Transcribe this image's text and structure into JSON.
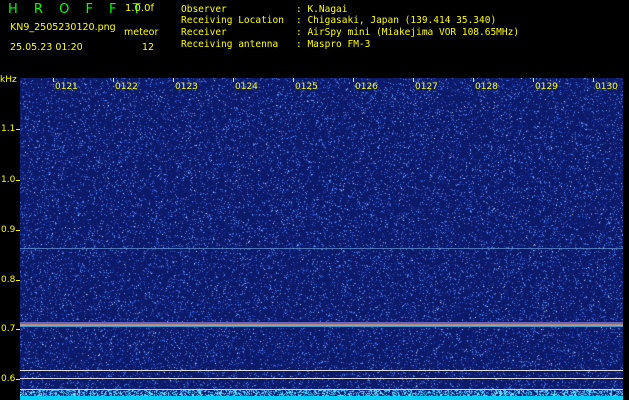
{
  "header": {
    "app_title": "H R O F F T",
    "app_version": "1.0.0f",
    "file_name": "KN9_2505230120.png",
    "meteor_label": "meteor",
    "datetime": "25.05.23 01:20",
    "meteor_count": "12"
  },
  "info": [
    {
      "label": "Observer",
      "value": ": K.Nagai"
    },
    {
      "label": "Receiving Location",
      "value": ": Chigasaki, Japan (139.414 35.340)"
    },
    {
      "label": "Receiver",
      "value": ": AirSpy mini (Miakejima VOR 108.65MHz)"
    },
    {
      "label": "Receiving antenna",
      "value": ": Maspro FM-3"
    }
  ],
  "spectrogram": {
    "unit_label": "kHz",
    "y_labels": [
      "1.1",
      "1.0",
      "0.9",
      "0.8",
      "0.7",
      "0.6"
    ],
    "time_labels": [
      "0121",
      "0122",
      "0123",
      "0124",
      "0125",
      "0126",
      "0127",
      "0128",
      "0129",
      "0130"
    ],
    "colors": {
      "background": "#0c1a6a",
      "signal": "#ff3050",
      "text": "#ffff00",
      "title": "#00ff00",
      "axis_bar": "#00d0ff"
    }
  }
}
